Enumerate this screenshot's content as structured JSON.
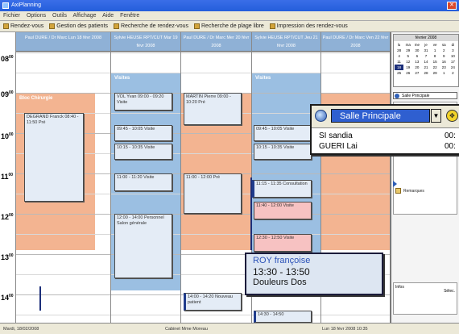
{
  "window": {
    "title": "AxiPlanning"
  },
  "menu": {
    "items": [
      "Fichier",
      "Options",
      "Outils",
      "Affichage",
      "Aide",
      "Fenêtre"
    ]
  },
  "toolbar": {
    "buttons": [
      "Rendez-vous",
      "Gestion des patients",
      "Recherche de rendez-vous",
      "Recherche de plage libre",
      "Impression des rendez-vous"
    ]
  },
  "calendar": {
    "hours": [
      "08",
      "09",
      "10",
      "11",
      "12",
      "13",
      "14"
    ],
    "hour_suffix": "00",
    "days": [
      {
        "header": "Paul DURE / Dr Marc Lun 18 févr 2008"
      },
      {
        "header": "Sylvie HEUSE RPT/CUT Mar 19 févr 2008"
      },
      {
        "header": "Paul DURE / Dr Marc Mer 20 févr 2008"
      },
      {
        "header": "Sylvie HEUSE RPT/CUT Jeu 21 févr 2008"
      },
      {
        "header": "Paul DURE / Dr Marc Ven 22 févr 2008"
      }
    ],
    "band_labels": {
      "orange": "Bloc Chirurgie",
      "blue": "Visites"
    },
    "appointments": [
      {
        "text": "DEGRAND Franck 08:40 - 11:50 Pré"
      },
      {
        "text": "VOL Yvan 09:00 - 09:20 Visite"
      },
      {
        "text": "09:45 - 10:05 Visite"
      },
      {
        "text": "10:15 - 10:35 Visite"
      },
      {
        "text": "11:00 - 11:20 Visite"
      },
      {
        "text": "12:00 - 14:00 Personnel Salon générale"
      },
      {
        "text": "MARTIN Pierre 09:00 - 10:20 Pré"
      },
      {
        "text": "11:00 - 12:00 Pré"
      },
      {
        "text": "09:45 - 10:05 Visite"
      },
      {
        "text": "10:15 - 10:35 Visite"
      },
      {
        "text": "11:15 - 11:35 Consultation"
      },
      {
        "text": "11:40 - 12:00 Visite"
      },
      {
        "text": "12:30 - 12:50 Visite"
      },
      {
        "text": "14:00 - 14:20 Nouveau patient"
      },
      {
        "text": "14:30 - 14:50"
      }
    ]
  },
  "popup_salle": {
    "room": "Salle Principale",
    "rows": [
      {
        "name": "SI sandia",
        "time": "00:"
      },
      {
        "name": "GUERI Lai",
        "time": "00:"
      }
    ]
  },
  "popup_appt": {
    "name": "ROY françoise",
    "time": "13:30 - 13:50",
    "reason": "Douleurs Dos"
  },
  "right_panel": {
    "month": "février 2008",
    "weekdays": [
      "lu",
      "ma",
      "me",
      "je",
      "ve",
      "sa",
      "di"
    ],
    "days": [
      "28",
      "29",
      "30",
      "31",
      "1",
      "2",
      "3",
      "4",
      "5",
      "6",
      "7",
      "8",
      "9",
      "10",
      "11",
      "12",
      "13",
      "14",
      "15",
      "16",
      "17",
      "18",
      "19",
      "20",
      "21",
      "22",
      "23",
      "24",
      "25",
      "26",
      "27",
      "28",
      "29",
      "1",
      "2"
    ],
    "selected_day": "18",
    "select_value": "Salle Principale",
    "remarks_label": "Remarques",
    "note_label": "Infos",
    "note_button": "Sélec."
  },
  "statusbar": {
    "left": "Mardi, 18/02/2008",
    "middle": "Cabinet Mme Moreau",
    "right": "Lun 18 févr 2008 10:35"
  },
  "colors": {
    "orange": "#f3b491",
    "blue": "#9bbfe2",
    "header": "#8fb1d6",
    "accent": "#2f5fd0"
  }
}
